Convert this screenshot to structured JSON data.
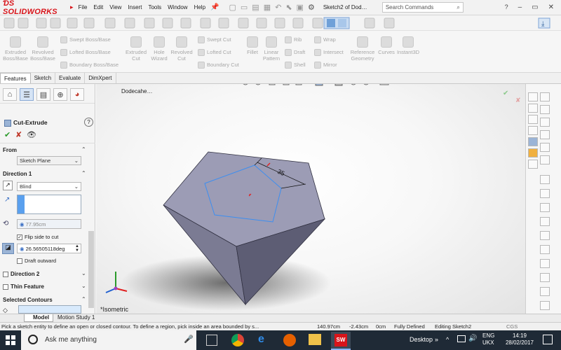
{
  "app": {
    "logo_text": "SOLIDWORKS",
    "document_title": "Sketch2 of Dod…",
    "brand_color": "#d8141a"
  },
  "menu": [
    "File",
    "Edit",
    "View",
    "Insert",
    "Tools",
    "Window",
    "Help"
  ],
  "search": {
    "placeholder": "Search Commands"
  },
  "ribbon": {
    "extruded_boss": "Extruded Boss/Base",
    "revolved_boss": "Revolved Boss/Base",
    "swept_boss": "Swept Boss/Base",
    "lofted_boss": "Lofted Boss/Base",
    "boundary_boss": "Boundary Boss/Base",
    "extruded_cut": "Extruded Cut",
    "hole_wizard": "Hole Wizard",
    "revolved_cut": "Revolved Cut",
    "swept_cut": "Swept Cut",
    "lofted_cut": "Lofted Cut",
    "boundary_cut": "Boundary Cut",
    "fillet": "Fillet",
    "linear_pattern": "Linear Pattern",
    "rib": "Rib",
    "draft": "Draft",
    "shell": "Shell",
    "wrap": "Wrap",
    "intersect": "Intersect",
    "mirror": "Mirror",
    "reference_geometry": "Reference Geometry",
    "curves": "Curves",
    "instant3d": "Instant3D"
  },
  "tabs": [
    "Features",
    "Sketch",
    "Evaluate",
    "DimXpert"
  ],
  "property_manager": {
    "title": "Cut-Extrude",
    "from_label": "From",
    "from_value": "Sketch Plane",
    "direction1_label": "Direction 1",
    "end_condition": "Blind",
    "depth_value": "77.95cm",
    "flip_side_label": "Flip side to cut",
    "draft_angle": "26.56505118deg",
    "draft_outward_label": "Draft outward",
    "direction2_label": "Direction 2",
    "thin_feature_label": "Thin Feature",
    "selected_contours_label": "Selected Contours"
  },
  "viewport": {
    "tree_label": "Dodecahe…",
    "view_label": "*Isometric",
    "dimension_value": "35"
  },
  "bottom_tabs": [
    "Model",
    "Motion Study 1"
  ],
  "status": {
    "message": "Pick a sketch entity to define an open or closed contour. To define a region, pick inside an area bounded by s...",
    "x": "140.97cm",
    "y": "-2.43cm",
    "z": "0cm",
    "state": "Fully Defined",
    "editing": "Editing Sketch2",
    "units": "CGS"
  },
  "taskbar": {
    "search_placeholder": "Ask me anything",
    "desktop_label": "Desktop",
    "lang": "ENG",
    "region": "UKX",
    "time": "14:19",
    "date": "28/02/2017"
  }
}
